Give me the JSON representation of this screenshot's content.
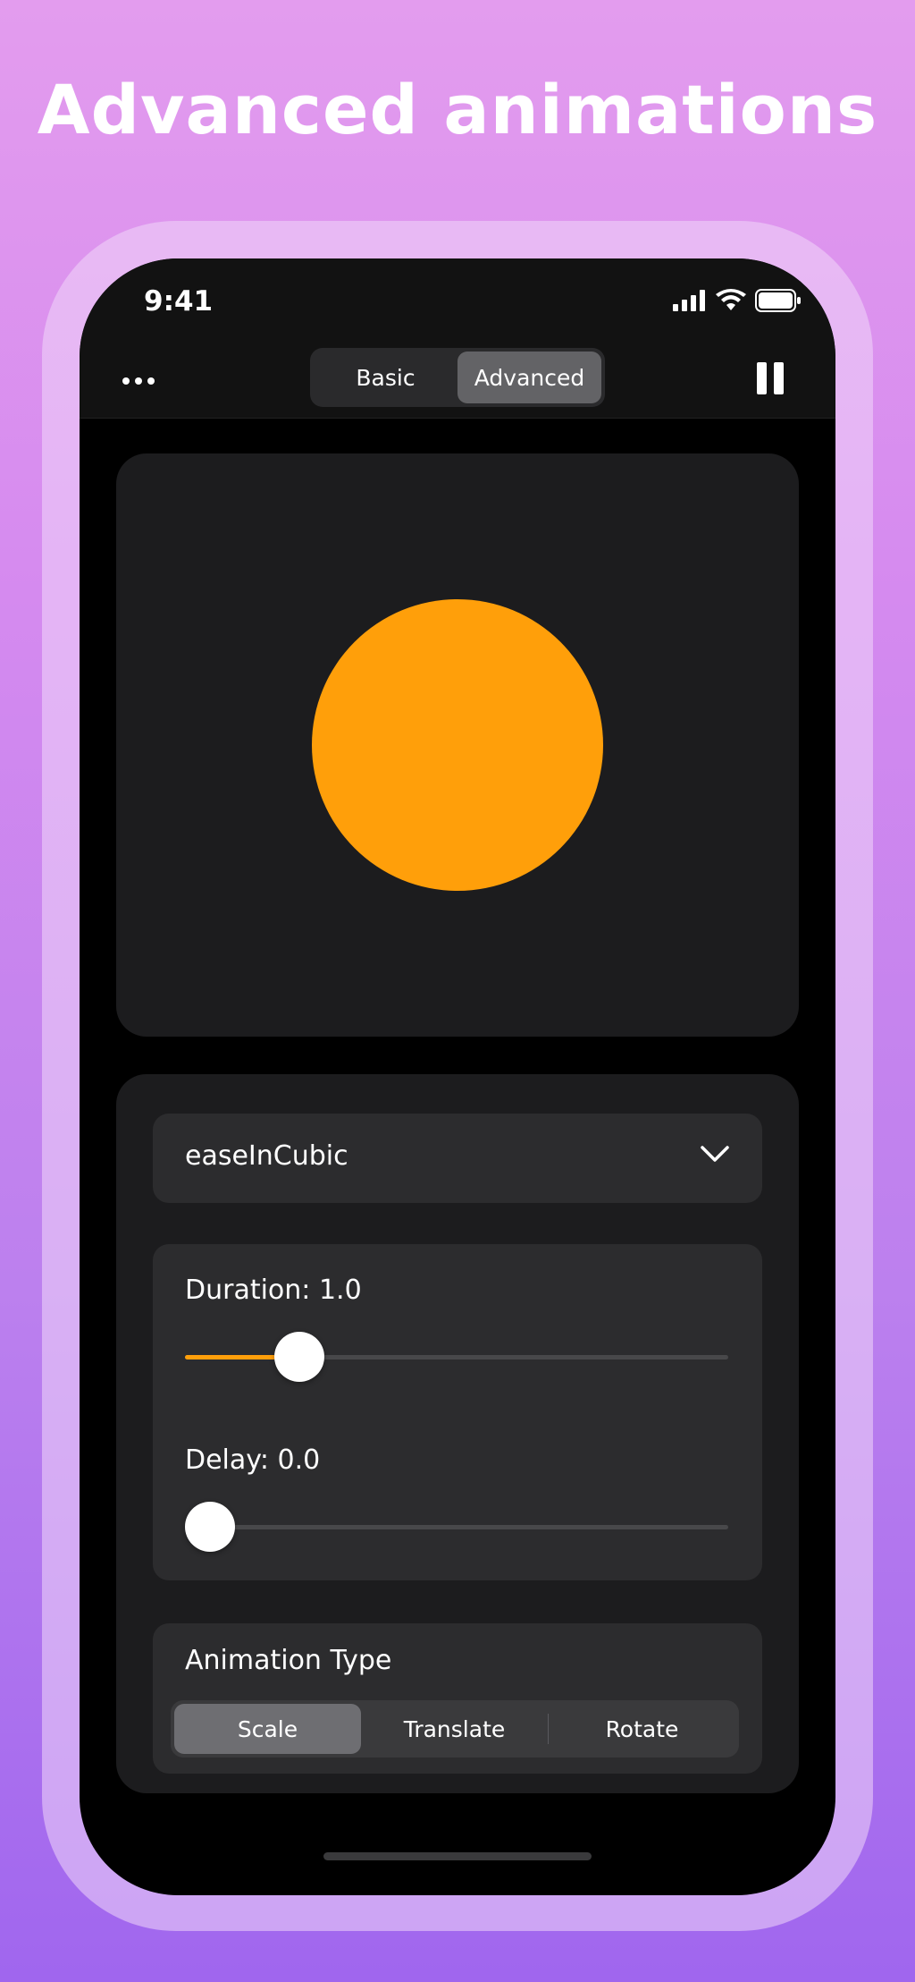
{
  "headline": "Advanced animations",
  "status_bar": {
    "time": "9:41",
    "icons": [
      "cellular-signal-icon",
      "wifi-icon",
      "battery-icon"
    ]
  },
  "nav": {
    "more_icon": "more-horizontal-icon",
    "tabs": [
      {
        "label": "Basic",
        "active": false
      },
      {
        "label": "Advanced",
        "active": true
      }
    ],
    "pause_icon": "pause-icon"
  },
  "preview": {
    "shape_color": "#ff9f0a"
  },
  "controls": {
    "easing": {
      "selected": "easeInCubic",
      "icon": "chevron-down-icon"
    },
    "duration": {
      "label": "Duration: 1.0",
      "fill_fraction": 0.21
    },
    "delay": {
      "label": "Delay: 0.0",
      "fill_fraction": 0.0
    },
    "animation_type": {
      "label": "Animation Type",
      "options": [
        {
          "label": "Scale",
          "active": true
        },
        {
          "label": "Translate",
          "active": false
        },
        {
          "label": "Rotate",
          "active": false
        }
      ]
    }
  },
  "colors": {
    "accent": "#ff9f0a",
    "card": "#1c1c1e",
    "control": "#2c2c2e"
  }
}
